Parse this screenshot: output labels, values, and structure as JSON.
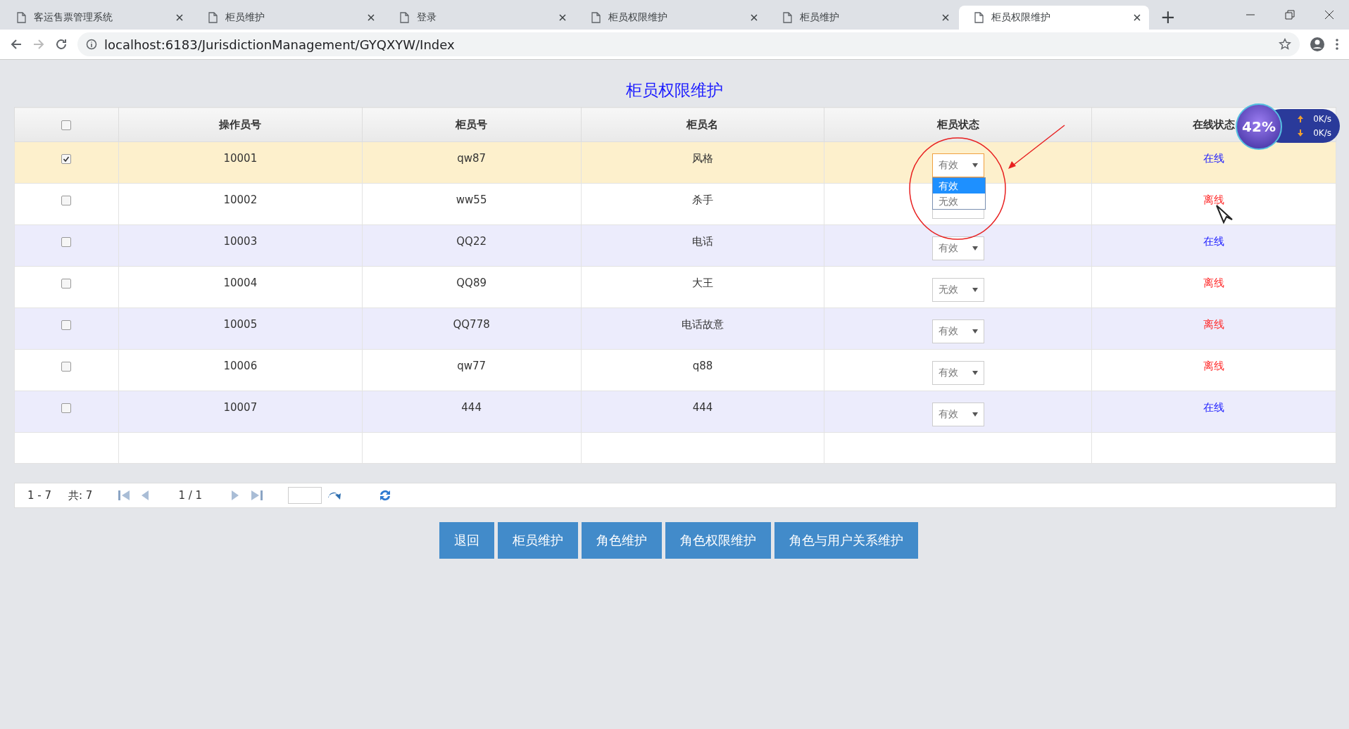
{
  "browser": {
    "tabs": [
      {
        "label": "客运售票管理系统",
        "selected": false
      },
      {
        "label": "柜员维护",
        "selected": false
      },
      {
        "label": "登录",
        "selected": false
      },
      {
        "label": "柜员权限维护",
        "selected": false
      },
      {
        "label": "柜员维护",
        "selected": false
      },
      {
        "label": "柜员权限维护",
        "selected": true
      }
    ],
    "new_tab": "+",
    "url": "localhost:6183/JurisdictionManagement/GYQXYW/Index"
  },
  "page": {
    "title": "柜员权限维护",
    "table": {
      "header_checked": false,
      "columns": [
        "操作员号",
        "柜员号",
        "柜员名",
        "柜员状态",
        "在线状态"
      ],
      "rows": [
        {
          "checked": true,
          "selected": true,
          "operator_no": "10001",
          "teller_no": "qw87",
          "teller_name": "风格",
          "status": "有效",
          "expanded": true,
          "options": [
            {
              "label": "有效",
              "selected": true
            },
            {
              "label": "无效",
              "selected": false
            }
          ],
          "online": "在线",
          "is_online": true
        },
        {
          "checked": false,
          "selected": false,
          "operator_no": "10002",
          "teller_no": "ww55",
          "teller_name": "杀手",
          "expanded": false,
          "online": "离线",
          "is_online": false
        },
        {
          "checked": false,
          "selected": false,
          "operator_no": "10003",
          "teller_no": "QQ22",
          "teller_name": "电话",
          "status": "有效",
          "expanded": false,
          "online": "在线",
          "is_online": true
        },
        {
          "checked": false,
          "selected": false,
          "operator_no": "10004",
          "teller_no": "QQ89",
          "teller_name": "大王",
          "status": "无效",
          "expanded": false,
          "online": "离线",
          "is_online": false
        },
        {
          "checked": false,
          "selected": false,
          "operator_no": "10005",
          "teller_no": "QQ778",
          "teller_name": "电话故意",
          "status": "有效",
          "expanded": false,
          "online": "离线",
          "is_online": false
        },
        {
          "checked": false,
          "selected": false,
          "operator_no": "10006",
          "teller_no": "qw77",
          "teller_name": "q88",
          "status": "有效",
          "expanded": false,
          "online": "离线",
          "is_online": false
        },
        {
          "checked": false,
          "selected": false,
          "operator_no": "10007",
          "teller_no": "444",
          "teller_name": "444",
          "status": "有效",
          "expanded": false,
          "online": "在线",
          "is_online": true
        }
      ]
    },
    "pagination": {
      "range": "1 - 7",
      "total": "共: 7",
      "page": "1 / 1"
    },
    "buttons": [
      "退回",
      "柜员维护",
      "角色维护",
      "角色权限维护",
      "角色与用户关系维护"
    ]
  },
  "speed_widget": {
    "percent": "42%",
    "upload": "0K/s",
    "download": "0K/s"
  }
}
